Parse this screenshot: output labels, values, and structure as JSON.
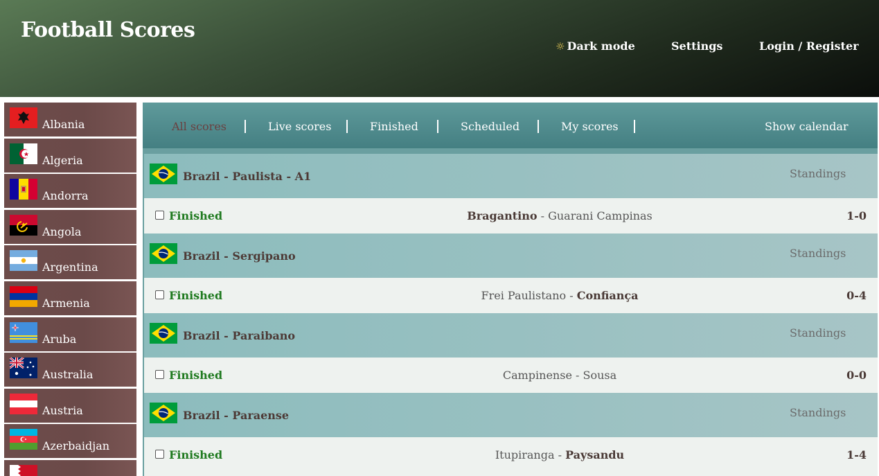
{
  "header": {
    "title": "Football Scores",
    "dark_mode_label": "Dark mode",
    "settings_label": "Settings",
    "login_label": "Login / Register"
  },
  "sidebar": {
    "countries": [
      {
        "name": "Albania",
        "flag": "albania-flag"
      },
      {
        "name": "Algeria",
        "flag": "algeria-flag"
      },
      {
        "name": "Andorra",
        "flag": "andorra-flag"
      },
      {
        "name": "Angola",
        "flag": "angola-flag"
      },
      {
        "name": "Argentina",
        "flag": "argentina-flag"
      },
      {
        "name": "Armenia",
        "flag": "armenia-flag"
      },
      {
        "name": "Aruba",
        "flag": "aruba-flag"
      },
      {
        "name": "Australia",
        "flag": "australia-flag"
      },
      {
        "name": "Austria",
        "flag": "austria-flag"
      },
      {
        "name": "Azerbaidjan",
        "flag": "azerbaijan-flag"
      },
      {
        "name": "",
        "flag": "bahrain-flag"
      }
    ]
  },
  "tabs": {
    "all": "All scores",
    "live": "Live scores",
    "finished": "Finished",
    "scheduled": "Scheduled",
    "my": "My scores",
    "calendar": "Show calendar",
    "active": "all"
  },
  "leagues": [
    {
      "name": "Brazil - Paulista - A1",
      "standings": "Standings",
      "match": {
        "status": "Finished",
        "home": "Bragantino",
        "away": "Guarani Campinas",
        "score": "1-0",
        "winner": "home"
      }
    },
    {
      "name": "Brazil - Sergipano",
      "standings": "Standings",
      "match": {
        "status": "Finished",
        "home": "Frei Paulistano",
        "away": "Confiança",
        "score": "0-4",
        "winner": "away"
      }
    },
    {
      "name": "Brazil - Paraibano",
      "standings": "Standings",
      "match": {
        "status": "Finished",
        "home": "Campinense",
        "away": "Sousa",
        "score": "0-0",
        "winner": "none"
      }
    },
    {
      "name": "Brazil - Paraense",
      "standings": "Standings",
      "match": {
        "status": "Finished",
        "home": "Itupiranga",
        "away": "Paysandu",
        "score": "1-4",
        "winner": "away"
      }
    }
  ],
  "colors": {
    "finished_status": "#1f7a1f",
    "sidebar_item": "#6b4a49",
    "tab_bar": "#447f82",
    "league_header": "#98c0c1"
  }
}
